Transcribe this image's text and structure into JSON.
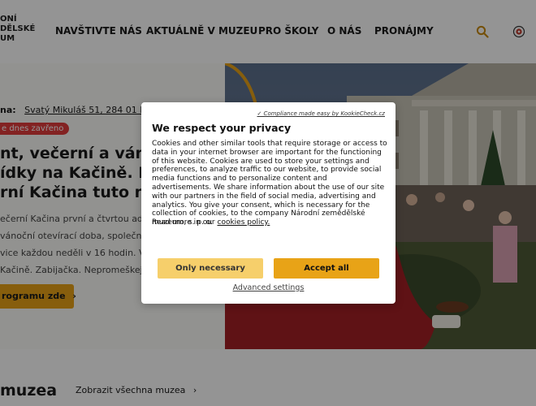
{
  "header": {
    "logo_lines": [
      "ONÍ",
      "DĚLSKÉ",
      "UM"
    ],
    "nav": [
      "NAVŠTIVTE NÁS",
      "AKTUÁLNĚ V MUZEU",
      "PRO ŠKOLY",
      "O NÁS",
      "PRONÁJMY"
    ],
    "search_icon": "search-icon",
    "language_icon": "language-icon"
  },
  "hero": {
    "address_label": "na:",
    "address_value": "Svatý Mikuláš 51, 284 01 Kutná",
    "status_badge": "e dnes zavřeno",
    "title_lines": [
      "nt, večerní a váno",
      "ídky na Kačině. Ko",
      "rní Kačina tuto ned"
    ],
    "text_lines": [
      "ečerní Kačina první a čtvrtou advent",
      " vánoční otevírací doba, společné ro",
      "vice každou neděli v 16 hodin. V ned",
      " Kačině. Zabijačka. Nepromeškejte V"
    ],
    "program_button": "rogramu zde",
    "accent_color": "#e8a317",
    "badge_color": "#e23b3b"
  },
  "museums": {
    "title": "muzea",
    "link": "Zobrazit všechna muzea"
  },
  "consent": {
    "compliance_link": "✓ Compliance made easy by KookieCheck.cz",
    "title": "We respect your privacy",
    "body": "Cookies and other similar tools that require storage or access to data in your internet browser are important for the functioning of this website. Cookies are used to store your settings and preferences, to analyze traffic to our website, to provide social media functions and to personalize content and advertisements. We share information about the use of our site with our partners in the field of social media, advertising and analytics. You give your consent, which is necessary for the collection of cookies, to the company Národní zemědělské muzeum, s. p. o.",
    "read_more": "Read more in our",
    "policy_link": "cookies policy.",
    "only_necessary": "Only necessary",
    "accept_all": "Accept all",
    "advanced": "Advanced settings"
  }
}
